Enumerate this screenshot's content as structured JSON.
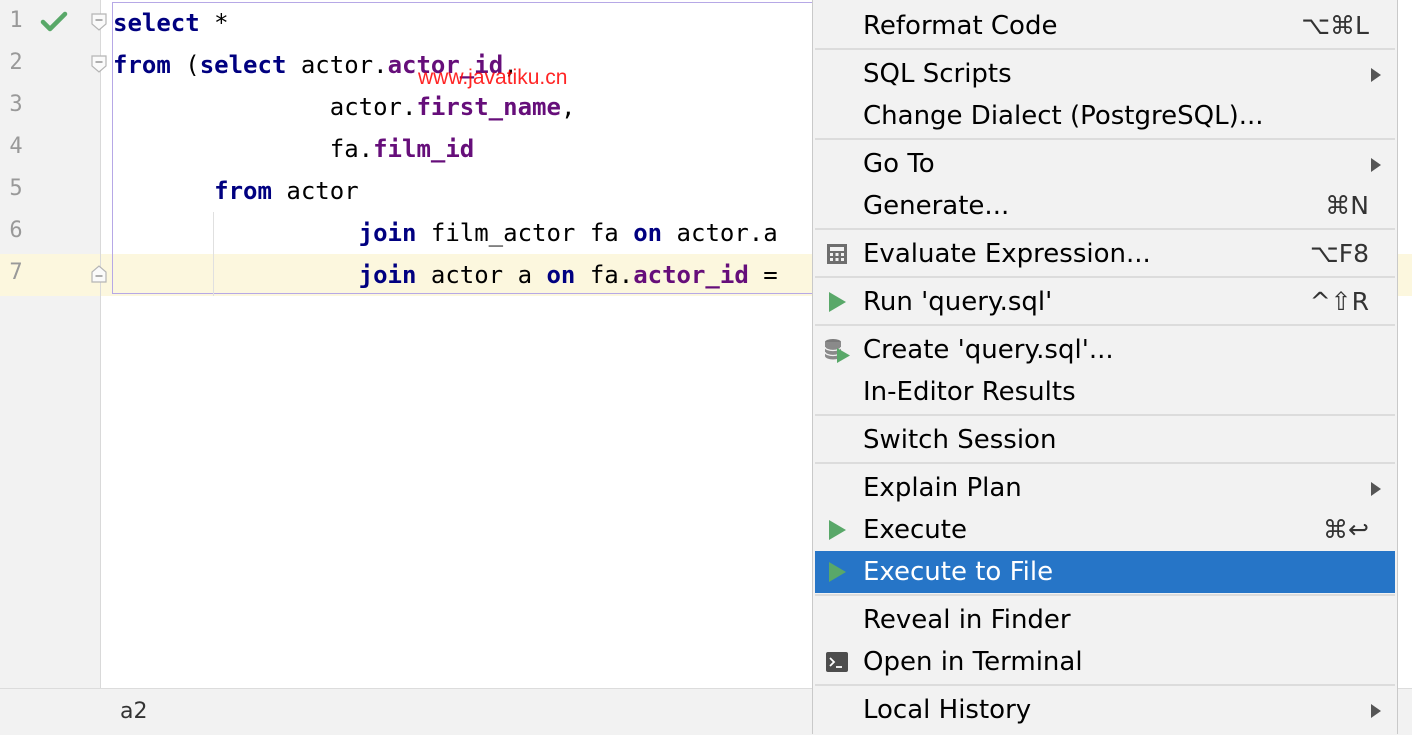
{
  "editor": {
    "line_numbers": [
      "1",
      "2",
      "3",
      "4",
      "5",
      "6",
      "7"
    ],
    "lines": [
      [
        {
          "t": "select",
          "c": "kw"
        },
        {
          "t": " *",
          "c": ""
        }
      ],
      [
        {
          "t": "from",
          "c": "kw"
        },
        {
          "t": " (",
          "c": ""
        },
        {
          "t": "select",
          "c": "kw"
        },
        {
          "t": " actor.",
          "c": ""
        },
        {
          "t": "actor_id",
          "c": "fld"
        },
        {
          "t": ",",
          "c": ""
        }
      ],
      [
        {
          "t": "               actor.",
          "c": ""
        },
        {
          "t": "first_name",
          "c": "fld"
        },
        {
          "t": ",",
          "c": ""
        }
      ],
      [
        {
          "t": "               fa.",
          "c": ""
        },
        {
          "t": "film_id",
          "c": "fld"
        }
      ],
      [
        {
          "t": "       ",
          "c": ""
        },
        {
          "t": "from",
          "c": "kw"
        },
        {
          "t": " actor",
          "c": ""
        }
      ],
      [
        {
          "t": "                 ",
          "c": ""
        },
        {
          "t": "join",
          "c": "kw"
        },
        {
          "t": " film_actor fa ",
          "c": ""
        },
        {
          "t": "on",
          "c": "kw"
        },
        {
          "t": " actor.a",
          "c": ""
        }
      ],
      [
        {
          "t": "                 ",
          "c": ""
        },
        {
          "t": "join",
          "c": "kw"
        },
        {
          "t": " actor a ",
          "c": ""
        },
        {
          "t": "on",
          "c": "kw"
        },
        {
          "t": " fa.",
          "c": ""
        },
        {
          "t": "actor_id",
          "c": "fld"
        },
        {
          "t": " =",
          "c": ""
        }
      ]
    ],
    "watermark": "www.javatiku.cn",
    "status_text": "a2",
    "check_icon": "checkmark-icon",
    "colors": {
      "keyword": "#000080",
      "field": "#660e7a",
      "check": "#59a869",
      "current_line": "#fcf7de"
    }
  },
  "menu": {
    "groups": [
      [
        {
          "label": "Reformat Code",
          "shortcut": "⌥⌘L"
        }
      ],
      [
        {
          "label": "SQL Scripts",
          "submenu": true
        },
        {
          "label": "Change Dialect (PostgreSQL)..."
        }
      ],
      [
        {
          "label": "Go To",
          "submenu": true
        },
        {
          "label": "Generate...",
          "shortcut": "⌘N"
        }
      ],
      [
        {
          "label": "Evaluate Expression...",
          "shortcut": "⌥F8",
          "icon": "calculator-icon"
        }
      ],
      [
        {
          "label": "Run 'query.sql'",
          "shortcut": "^⇧R",
          "icon": "run-icon"
        }
      ],
      [
        {
          "label": "Create 'query.sql'...",
          "icon": "database-run-icon"
        },
        {
          "label": "In-Editor Results"
        }
      ],
      [
        {
          "label": "Switch Session"
        }
      ],
      [
        {
          "label": "Explain Plan",
          "submenu": true
        },
        {
          "label": "Execute",
          "shortcut": "⌘↩",
          "icon": "run-icon"
        },
        {
          "label": "Execute to File",
          "icon": "run-icon",
          "selected": true
        }
      ],
      [
        {
          "label": "Reveal in Finder"
        },
        {
          "label": "Open in Terminal",
          "icon": "terminal-icon"
        }
      ],
      [
        {
          "label": "Local History",
          "submenu": true
        }
      ]
    ],
    "colors": {
      "selected_bg": "#2675c7",
      "run_icon": "#59a869"
    }
  }
}
